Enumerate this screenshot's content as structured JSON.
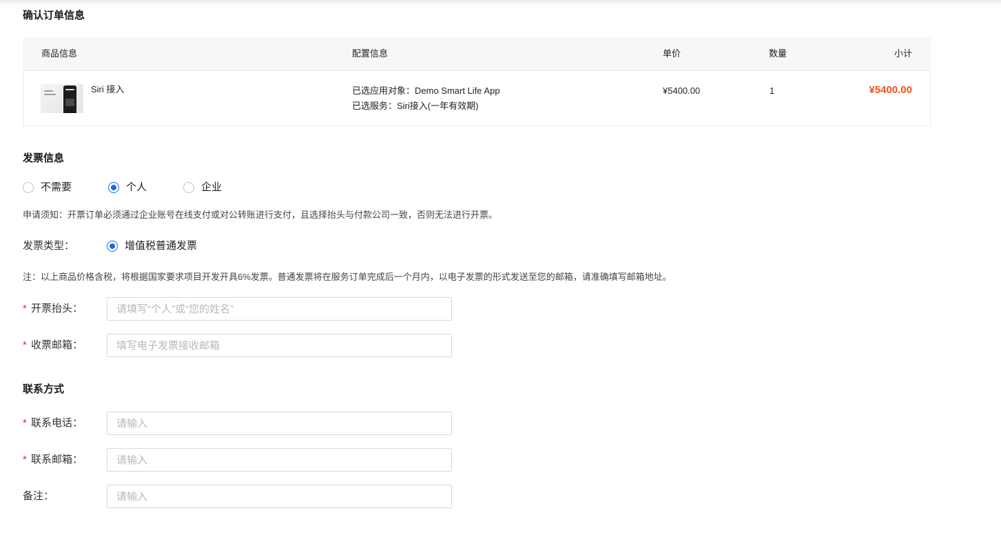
{
  "colors": {
    "accent": "#1769f0",
    "price": "#f5501e",
    "required": "#f5222d",
    "header_bg": "#f7f7f8"
  },
  "order": {
    "title": "确认订单信息",
    "columns": {
      "product": "商品信息",
      "config": "配置信息",
      "price": "单价",
      "qty": "数量",
      "subtotal": "小计"
    },
    "items": [
      {
        "name": "Siri 接入",
        "thumbnail_icon": "siri-product-thumbnail",
        "config": [
          "已选应用对象：Demo Smart Life App",
          "已选服务：Siri接入(一年有效期)"
        ],
        "price": "¥5400.00",
        "qty": "1",
        "subtotal": "¥5400.00"
      }
    ]
  },
  "invoice": {
    "title": "发票信息",
    "need_options": [
      {
        "label": "不需要",
        "checked": false
      },
      {
        "label": "个人",
        "checked": true
      },
      {
        "label": "企业",
        "checked": false
      }
    ],
    "notice": "申请须知：开票订单必须通过企业账号在线支付或对公转账进行支付，且选择抬头与付款公司一致，否则无法进行开票。",
    "type": {
      "label": "发票类型：",
      "options": [
        {
          "label": "增值税普通发票",
          "checked": true
        }
      ]
    },
    "note": "注：以上商品价格含税，将根据国家要求项目开发开具6%发票。普通发票将在服务订单完成后一个月内，以电子发票的形式发送至您的邮箱，请准确填写邮箱地址。",
    "fields": [
      {
        "required_mark": "*",
        "label": "开票抬头：",
        "placeholder": "请填写“个人”或“您的姓名”",
        "value": ""
      },
      {
        "required_mark": "*",
        "label": "收票邮箱：",
        "placeholder": "填写电子发票接收邮箱",
        "value": ""
      }
    ]
  },
  "contact": {
    "title": "联系方式",
    "fields": [
      {
        "required_mark": "*",
        "label": "联系电话：",
        "placeholder": "请输入",
        "value": ""
      },
      {
        "required_mark": "*",
        "label": "联系邮箱：",
        "placeholder": "请输入",
        "value": ""
      },
      {
        "label": "备注：",
        "placeholder": "请输入",
        "value": ""
      }
    ]
  }
}
